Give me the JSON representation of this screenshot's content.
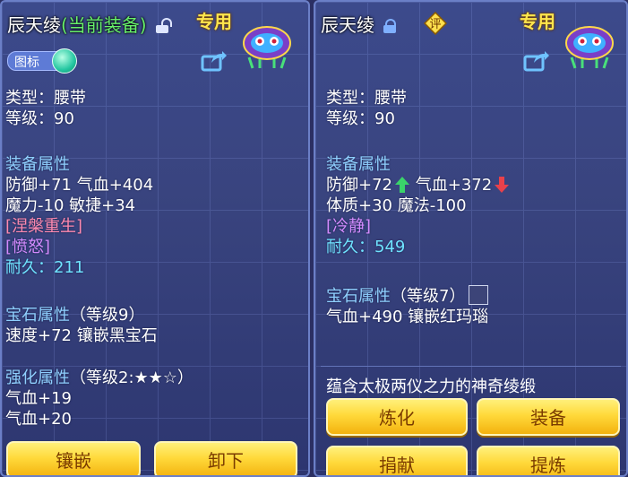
{
  "left": {
    "title_name": "辰天绫",
    "title_suffix": "(当前装备)",
    "special_label": "专用",
    "toggle_label": "图标",
    "type_line": "类型：腰带",
    "level_line": "等级：90",
    "equip_attr_title": "装备属性",
    "attr_line1": "防御+71 气血+404",
    "attr_line2": "魔力-10 敏捷+34",
    "special_effect": "[涅槃重生]",
    "special_skill": "[愤怒]",
    "durability": "耐久：211",
    "gem_attr_title": "宝石属性",
    "gem_level": "（等级9）",
    "gem_line": "速度+72 镶嵌黑宝石",
    "forge_attr_title": "强化属性",
    "forge_level": "（等级2:★★☆）",
    "forge_line1": "气血+19",
    "forge_line2": "气血+20",
    "buttons": {
      "inlay": "镶嵌",
      "unequip": "卸下"
    }
  },
  "right": {
    "title_name": "辰天绫",
    "ping_label": "评",
    "special_label": "专用",
    "type_line": "类型：腰带",
    "level_line": "等级：90",
    "equip_attr_title": "装备属性",
    "attr_defense": "防御+72",
    "attr_hp": "气血+372",
    "attr_line2": "体质+30 魔法-100",
    "special_effect": "[冷静]",
    "durability": "耐久：549",
    "gem_attr_title": "宝石属性",
    "gem_level": "（等级7）",
    "gem_line": "气血+490 镶嵌红玛瑙",
    "description": "蕴含太极两仪之力的神奇绫缎",
    "buttons": {
      "refine": "炼化",
      "equip": "装备",
      "donate": "捐献",
      "extract": "提炼"
    }
  },
  "colors": {
    "green_up": "#3ad36a",
    "red_down": "#e8414b",
    "button_gold": "#ffd93a"
  },
  "icons": [
    "lock-icon",
    "share-icon",
    "mask-icon",
    "arrow-up-icon",
    "arrow-down-icon",
    "gem-icon"
  ]
}
